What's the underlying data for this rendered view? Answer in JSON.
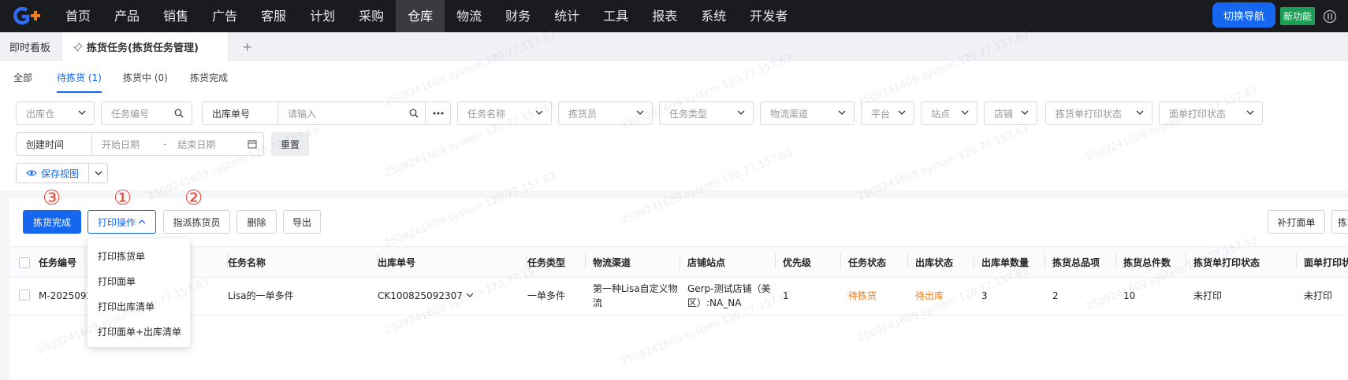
{
  "topnav": {
    "items": [
      "首页",
      "产品",
      "销售",
      "广告",
      "客服",
      "计划",
      "采购",
      "仓库",
      "物流",
      "财务",
      "统计",
      "工具",
      "报表",
      "系统",
      "开发者"
    ],
    "active": "仓库",
    "switch_nav": "切换导航",
    "new_feature": "新功能"
  },
  "pagetabs": {
    "dashboard": "即时看板",
    "current": "拣货任务(拣货任务管理)",
    "add": "+"
  },
  "subtabs": [
    "全部",
    "待拣货 (1)",
    "拣货中 (0)",
    "拣货完成"
  ],
  "filters": {
    "warehouse": "出库仓",
    "task_no": "任务编号",
    "outbound_label": "出库单号",
    "outbound_placeholder": "请输入",
    "task_name": "任务名称",
    "picker": "拣货员",
    "task_type": "任务类型",
    "logistics": "物流渠道",
    "platform": "平台",
    "site": "站点",
    "store": "店铺",
    "pick_print_status": "拣货单打印状态",
    "label_print_status": "面单打印状态",
    "created_time": "创建时间",
    "start_date": "开始日期",
    "date_sep": "-",
    "end_date": "结束日期",
    "reset": "重置",
    "save_view": "保存视图"
  },
  "actions": {
    "pick_done": "拣货完成",
    "print_ops": "打印操作",
    "assign_picker": "指派拣货员",
    "delete": "删除",
    "export": "导出",
    "reprint": "补打面单",
    "more_cut": "拣",
    "marker1": "①",
    "marker2": "②",
    "marker3": "③"
  },
  "dropdown": [
    "打印拣货单",
    "打印面单",
    "打印出库清单",
    "打印面单+出库清单"
  ],
  "table": {
    "headers": [
      "任务编号",
      "任务名称",
      "出库单号",
      "任务类型",
      "物流渠道",
      "店铺站点",
      "优先级",
      "任务状态",
      "出库状态",
      "出库单数量",
      "拣货总品项",
      "拣货总件数",
      "拣货单打印状态",
      "面单打印状"
    ],
    "row": {
      "task_no": "M-2025092",
      "task_name": "Lisa的一单多件",
      "outbound_no": "CK100825092307",
      "task_type": "一单多件",
      "logistics_1": "第一种Lisa自定义物",
      "logistics_2": "流",
      "store_1": "Gerp-测试店铺（美",
      "store_2": "区）:NA_NA",
      "priority": "1",
      "task_status": "待拣货",
      "outbound_status": "待出库",
      "order_count": "3",
      "total_items": "2",
      "total_qty": "10",
      "pick_print": "未打印",
      "label_print": "未打印"
    }
  },
  "watermark": "2509241609 system 120.77.157.63",
  "colors": {
    "accent": "#1667f0",
    "orange": "#f07c24",
    "nav_bg": "#1a1b1f",
    "green": "#1e9e55",
    "marker": "#e14a3c"
  }
}
